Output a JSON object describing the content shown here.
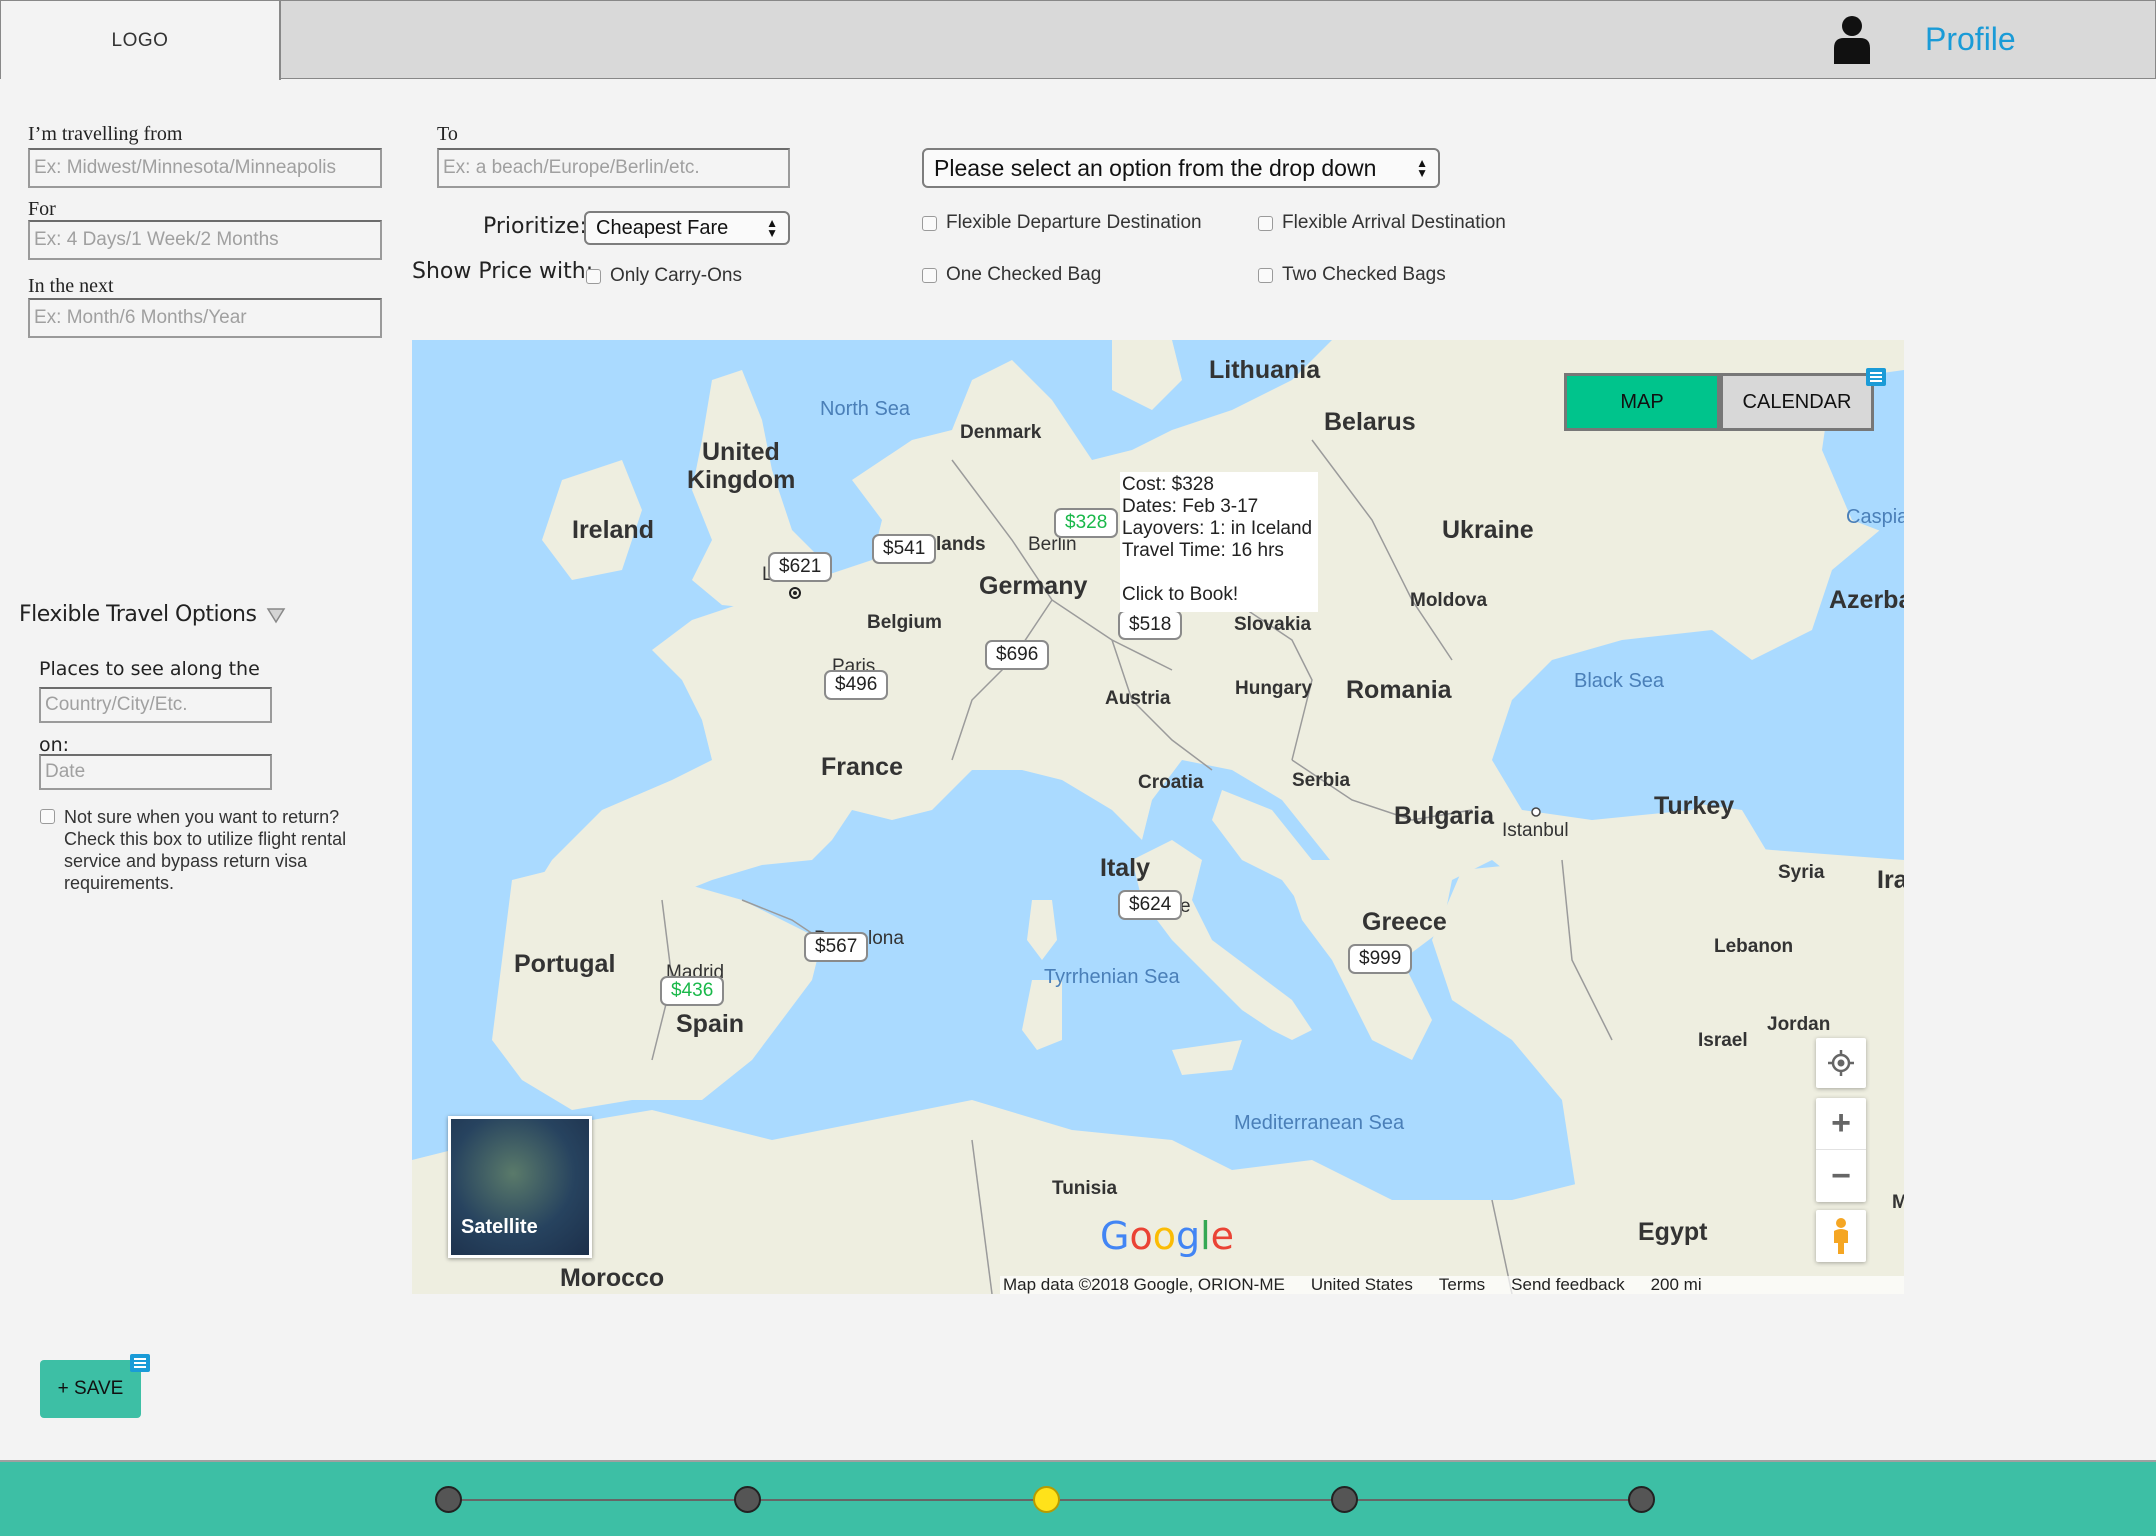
{
  "header": {
    "logo": "LOGO",
    "profile_label": "Profile"
  },
  "form": {
    "from_label": "I’m travelling from",
    "from_placeholder": "Ex: Midwest/Minnesota/Minneapolis",
    "to_label": "To",
    "to_placeholder": "Ex: a beach/Europe/Berlin/etc.",
    "for_label": "For",
    "for_placeholder": "Ex: 4 Days/1 Week/2 Months",
    "next_label": "In the next",
    "next_placeholder": "Ex: Month/6 Months/Year",
    "prioritize_label": "Prioritize:",
    "prioritize_value": "Cheapest Fare",
    "show_price_label": "Show Price with:",
    "carry_on_label": "Only Carry-Ons",
    "dropdown_value": "Please select an option from the drop down",
    "flex_departure_label": "Flexible Departure Destination",
    "flex_arrival_label": "Flexible Arrival Destination",
    "one_bag_label": "One Checked Bag",
    "two_bag_label": "Two Checked Bags"
  },
  "sidebar": {
    "flexible_title": "Flexible Travel Options",
    "places_label": "Places to see along the",
    "places_placeholder": "Country/City/Etc.",
    "on_label": "on:",
    "date_placeholder": "Date",
    "not_sure_text": "Not sure when you want to return? Check this box to utilize flight rental service and bypass return visa requirements.",
    "save_label": "+ SAVE"
  },
  "map": {
    "tabs": {
      "map": "MAP",
      "calendar": "CALENDAR"
    },
    "tooltip": {
      "cost": "Cost: $328",
      "dates": "Dates: Feb 3-17",
      "layovers": "Layovers: 1: in Iceland",
      "travel_time": "Travel Time: 16 hrs",
      "cta": "Click to Book!"
    },
    "countries": {
      "lithuania": "Lithuania",
      "belarus": "Belarus",
      "ukraine": "Ukraine",
      "uk1": "United",
      "uk2": "Kingdom",
      "ireland": "Ireland",
      "denmark": "Denmark",
      "germany": "Germany",
      "belgium": "Belgium",
      "france": "France",
      "austria": "Austria",
      "slovakia": "Slovakia",
      "hungary": "Hungary",
      "romania": "Romania",
      "moldova": "Moldova",
      "croatia": "Croatia",
      "serbia": "Serbia",
      "bulgaria": "Bulgaria",
      "italy": "Italy",
      "turkey": "Turkey",
      "greece": "Greece",
      "spain": "Spain",
      "portugal": "Portugal",
      "syria": "Syria",
      "lebanon": "Lebanon",
      "israel": "Israel",
      "jordan": "Jordan",
      "tunisia": "Tunisia",
      "egypt": "Egypt",
      "morocco": "Morocco",
      "azerba": "Azerba",
      "ira": "Ira",
      "caspia": "Caspia",
      "m": "M"
    },
    "cities": {
      "berlin": "Berlin",
      "lands": "lands",
      "paris": "Paris",
      "madrid": "Madrid",
      "barcelona_tail": "lona",
      "barcelona_head": "B",
      "istanbul": "Istanbul",
      "london_l": "L",
      "rome_e": "e",
      "vienna_c": "("
    },
    "waters": {
      "north_sea": "North Sea",
      "black_sea": "Black Sea",
      "tyrrhenian": "Tyrrhenian Sea",
      "mediterranean": "Mediterranean Sea"
    },
    "prices": [
      "$328",
      "$541",
      "$621",
      "$518",
      "$696",
      "$496",
      "$624",
      "$567",
      "$436",
      "$999"
    ],
    "satellite_label": "Satellite",
    "google_logo": "Google",
    "attribution": {
      "map_data": "Map data ©2018 Google, ORION-ME",
      "region": "United States",
      "terms": "Terms",
      "feedback": "Send feedback",
      "scale": "200 mi"
    }
  },
  "progress": {
    "steps": 5,
    "active_step": 3
  },
  "colors": {
    "accent": "#3dbfa5",
    "map_tab": "#00c48c",
    "link": "#1a9bd7",
    "active_dot": "#ffe21a",
    "price_green": "#1ab84a"
  }
}
